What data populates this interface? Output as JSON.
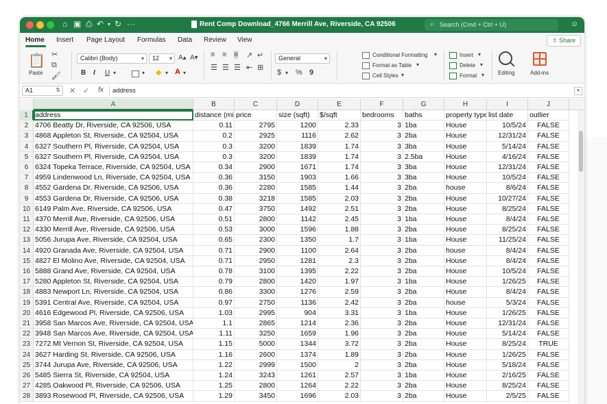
{
  "titlebar": {
    "title": "Rent Comp Download_4766 Merrill Ave, Riverside, CA 92506",
    "search_placeholder": "Search (Cmd + Ctrl + U)"
  },
  "tabs": [
    {
      "label": "Home",
      "active": true
    },
    {
      "label": "Insert"
    },
    {
      "label": "Page Layout"
    },
    {
      "label": "Formulas"
    },
    {
      "label": "Data"
    },
    {
      "label": "Review"
    },
    {
      "label": "View"
    }
  ],
  "share_label": "Share",
  "ribbon": {
    "paste_label": "Paste",
    "font_name": "Calibri (Body)",
    "font_size": "12",
    "number_format": "General",
    "conditional_formatting": "Conditional Formatting",
    "format_as_table": "Format as Table",
    "cell_styles": "Cell Styles",
    "insert": "Insert",
    "delete": "Delete",
    "format": "Format",
    "editing": "Editing",
    "addins": "Add-ins",
    "bold": "B",
    "italic": "I",
    "underline": "U",
    "currency": "$",
    "percent": "%",
    "comma": "9"
  },
  "formula": {
    "cell_ref": "A1",
    "content": "address",
    "fx": "fx"
  },
  "columns": [
    "A",
    "B",
    "C",
    "D",
    "E",
    "F",
    "G",
    "H",
    "I",
    "J"
  ],
  "headers": [
    "address",
    "distance (mi)",
    "price",
    "size (sqft)",
    "$/sqft",
    "bedrooms",
    "baths",
    "property type",
    "list date",
    "outlier"
  ],
  "rows": [
    [
      "4706 Beatty Dr, Riverside, CA 92506, USA",
      "0.11",
      "2795",
      "1200",
      "2.33",
      "3",
      "1ba",
      "House",
      "10/5/24",
      "FALSE"
    ],
    [
      "4868 Appleton St, Riverside, CA 92504, USA",
      "0.2",
      "2925",
      "1116",
      "2.62",
      "3",
      "2ba",
      "House",
      "12/31/24",
      "FALSE"
    ],
    [
      "6327 Southern Pl, Riverside, CA 92504, USA",
      "0.3",
      "3200",
      "1839",
      "1.74",
      "3",
      "3ba",
      "House",
      "5/14/24",
      "FALSE"
    ],
    [
      "6327 Southern Pl, Riverside, CA 92504, USA",
      "0.3",
      "3200",
      "1839",
      "1.74",
      "3",
      "2.5ba",
      "House",
      "4/16/24",
      "FALSE"
    ],
    [
      "6324 Topeka Terrace, Riverside, CA 92504, USA",
      "0.34",
      "2900",
      "1671",
      "1.74",
      "3",
      "3ba",
      "House",
      "12/31/24",
      "FALSE"
    ],
    [
      "4959 Lindenwood Ln, Riverside, CA 92504, USA",
      "0.36",
      "3150",
      "1903",
      "1.66",
      "3",
      "3ba",
      "House",
      "10/5/24",
      "FALSE"
    ],
    [
      "4552 Gardena Dr, Riverside, CA 92506, USA",
      "0.36",
      "2280",
      "1585",
      "1.44",
      "3",
      "2ba",
      "house",
      "8/6/24",
      "FALSE"
    ],
    [
      "4553 Gardena Dr, Riverside, CA 92506, USA",
      "0.38",
      "3218",
      "1585",
      "2.03",
      "3",
      "2ba",
      "House",
      "10/27/24",
      "FALSE"
    ],
    [
      "6149 Palm Ave, Riverside, CA 92506, USA",
      "0.47",
      "3750",
      "1492",
      "2.51",
      "3",
      "2ba",
      "House",
      "8/25/24",
      "FALSE"
    ],
    [
      "4370 Merrill Ave, Riverside, CA 92506, USA",
      "0.51",
      "2800",
      "1142",
      "2.45",
      "3",
      "1ba",
      "House",
      "8/4/24",
      "FALSE"
    ],
    [
      "4330 Merrill Ave, Riverside, CA 92506, USA",
      "0.53",
      "3000",
      "1596",
      "1.88",
      "3",
      "2ba",
      "House",
      "8/25/24",
      "FALSE"
    ],
    [
      "5056 Jurupa Ave, Riverside, CA 92504, USA",
      "0.65",
      "2300",
      "1350",
      "1.7",
      "3",
      "1ba",
      "House",
      "11/25/24",
      "FALSE"
    ],
    [
      "4920 Granada Ave, Riverside, CA 92504, USA",
      "0.71",
      "2900",
      "1100",
      "2.64",
      "3",
      "2ba",
      "house",
      "8/4/24",
      "FALSE"
    ],
    [
      "4827 El Molino Ave, Riverside, CA 92504, USA",
      "0.71",
      "2950",
      "1281",
      "2.3",
      "3",
      "2ba",
      "House",
      "8/4/24",
      "FALSE"
    ],
    [
      "5888 Grand Ave, Riverside, CA 92504, USA",
      "0.78",
      "3100",
      "1395",
      "2.22",
      "3",
      "2ba",
      "House",
      "10/5/24",
      "FALSE"
    ],
    [
      "5280 Appleton St, Riverside, CA 92504, USA",
      "0.79",
      "2800",
      "1420",
      "1.97",
      "3",
      "1ba",
      "House",
      "1/26/25",
      "FALSE"
    ],
    [
      "4883 Newport Ln, Riverside, CA 92504, USA",
      "0.86",
      "3300",
      "1276",
      "2.59",
      "3",
      "2ba",
      "House",
      "8/4/24",
      "FALSE"
    ],
    [
      "5391 Central Ave, Riverside, CA 92504, USA",
      "0.97",
      "2750",
      "1136",
      "2.42",
      "3",
      "2ba",
      "house",
      "5/3/24",
      "FALSE"
    ],
    [
      "4616 Edgewood Pl, Riverside, CA 92506, USA",
      "1.03",
      "2995",
      "904",
      "3.31",
      "3",
      "1ba",
      "House",
      "1/26/25",
      "FALSE"
    ],
    [
      "3958 San Marcos Ave, Riverside, CA 92504, USA",
      "1.1",
      "2865",
      "1214",
      "2.36",
      "3",
      "2ba",
      "House",
      "12/31/24",
      "FALSE"
    ],
    [
      "3948 San Marcos Ave, Riverside, CA 92504, USA",
      "1.11",
      "3250",
      "1659",
      "1.96",
      "3",
      "2ba",
      "House",
      "5/14/24",
      "FALSE"
    ],
    [
      "7272 Mt Vernon St, Riverside, CA 92504, USA",
      "1.15",
      "5000",
      "1344",
      "3.72",
      "3",
      "2ba",
      "House",
      "8/25/24",
      "TRUE"
    ],
    [
      "3627 Harding St, Riverside, CA 92506, USA",
      "1.16",
      "2600",
      "1374",
      "1.89",
      "3",
      "2ba",
      "House",
      "1/26/25",
      "FALSE"
    ],
    [
      "3744 Jurupa Ave, Riverside, CA 92506, USA",
      "1.22",
      "2999",
      "1500",
      "2",
      "3",
      "2ba",
      "House",
      "5/18/24",
      "FALSE"
    ],
    [
      "5485 Sierra St, Riverside, CA 92504, USA",
      "1.24",
      "3243",
      "1261",
      "2.57",
      "3",
      "1ba",
      "House",
      "2/16/25",
      "FALSE"
    ],
    [
      "4285 Oakwood Pl, Riverside, CA 92506, USA",
      "1.25",
      "2800",
      "1264",
      "2.22",
      "3",
      "2ba",
      "House",
      "8/25/24",
      "FALSE"
    ],
    [
      "3893 Rosewood Pl, Riverside, CA 92506, USA",
      "1.29",
      "3450",
      "1696",
      "2.03",
      "3",
      "2ba",
      "House",
      "2/5/25",
      "FALSE"
    ]
  ]
}
